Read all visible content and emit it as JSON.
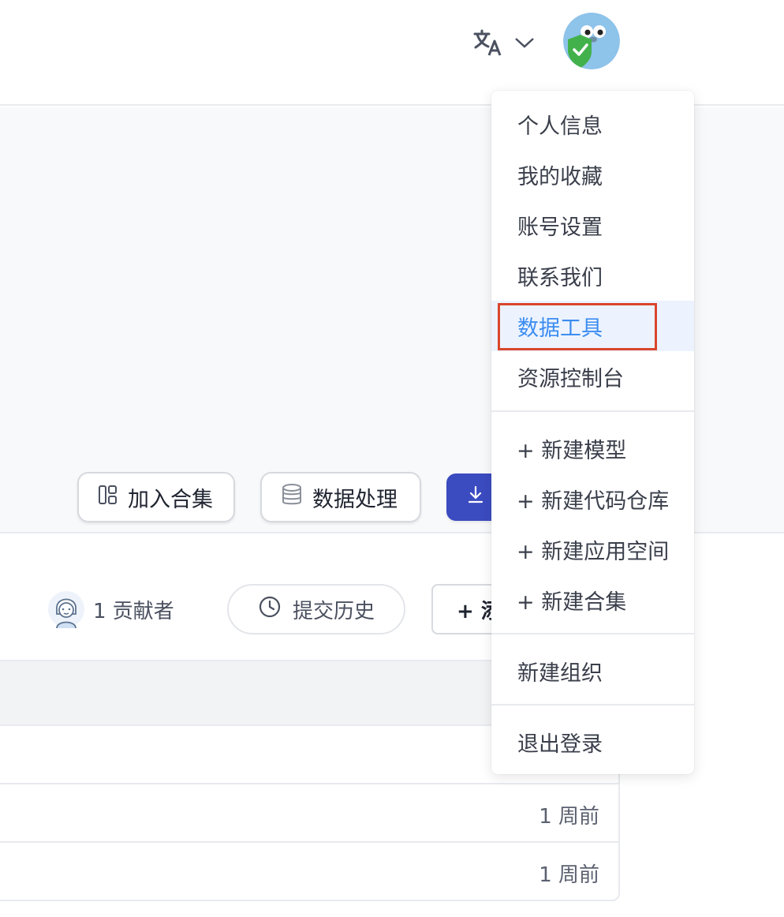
{
  "header": {
    "language_icon": "translate-icon",
    "chevron_icon": "chevron-down-icon",
    "avatar_icon": "gopher-avatar-icon"
  },
  "actions": {
    "add_collection": "加入合集",
    "data_processing": "数据处理",
    "download_icon": "download-icon"
  },
  "repo": {
    "contributors": "1 贡献者",
    "history": "提交历史",
    "add_label": "+ 添"
  },
  "files": {
    "rows": [
      {
        "time": ""
      },
      {
        "time": "1 周前"
      },
      {
        "time": "1 周前"
      }
    ]
  },
  "menu": {
    "items": [
      "个人信息",
      "我的收藏",
      "账号设置",
      "联系我们",
      "数据工具",
      "资源控制台"
    ],
    "create_items": [
      "+ 新建模型",
      "+ 新建代码仓库",
      "+ 新建应用空间",
      "+ 新建合集"
    ],
    "org": "新建组织",
    "logout": "退出登录",
    "active_item": "数据工具"
  },
  "colors": {
    "accent": "#3c8df0",
    "primary_button": "#3b4bc0",
    "highlight_border": "#d9462c"
  }
}
